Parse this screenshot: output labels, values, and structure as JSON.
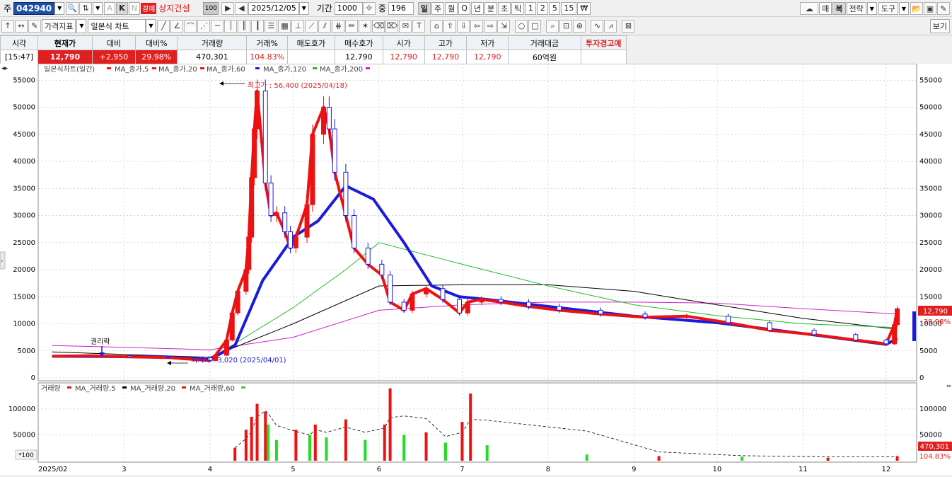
{
  "toolbar1": {
    "market_label": "주",
    "stock_code": "042940",
    "warning_badge": "경예",
    "stock_name": "상지건설",
    "check_value": "100",
    "date": "2025/12/05",
    "period_label": "기간",
    "period_value": "1000",
    "mid_label": "중",
    "mid_value": "196",
    "timeframes": [
      "일",
      "주",
      "월",
      "Q",
      "년",
      "분",
      "초",
      "틱",
      "1",
      "2",
      "5",
      "15"
    ],
    "currency_icon": "₩",
    "right_buttons": [
      "매",
      "복",
      "전략",
      "도구"
    ],
    "k_label": "K",
    "n_label": "N",
    "a_label": "A"
  },
  "toolbar2": {
    "indicator_button": "가격지표",
    "chart_type": "일본식 차트",
    "view_button": "보기"
  },
  "quote": {
    "headers": [
      "시각",
      "현재가",
      "대비",
      "대비%",
      "거래량",
      "거래%",
      "매도호가",
      "매수호가",
      "시가",
      "고가",
      "저가",
      "거래대금",
      "투자경고예"
    ],
    "values": [
      "[15:47]",
      "12,790",
      "+2,950",
      "29.98%",
      "470,301",
      "104.83%",
      "",
      "12,790",
      "12,790",
      "12,790",
      "12,790",
      "60억원",
      ""
    ]
  },
  "price_panel": {
    "legend_title": "일본식차트(일간)",
    "legend_items": [
      {
        "label": "MA_종가,5",
        "color": "#ee1111"
      },
      {
        "label": "MA_종가,20",
        "color": "#ee1111"
      },
      {
        "label": "MA_종가,60",
        "color": "#1a1adf"
      },
      {
        "label": "MA_종가,120",
        "color": "#22bb22"
      },
      {
        "label": "MA_종가,200",
        "color": "#000000"
      },
      {
        "label": "",
        "color": "#cc22cc"
      }
    ],
    "high_annotation": "최고가 : 56,400 (2025/04/18)",
    "low_annotation": "최저가 : 3,020 (2025/04/01)",
    "rights_annotation": "권리락",
    "y_ticks": [
      "55000",
      "50000",
      "45000",
      "40000",
      "35000",
      "30000",
      "25000",
      "20000",
      "15000",
      "10000",
      "5000",
      "0"
    ],
    "current_price_tag": "12,790",
    "current_pct_tag": "29.98%"
  },
  "volume_panel": {
    "legend_title": "거래량",
    "legend_items": [
      {
        "label": "MA_거래량,5",
        "color": "#ee1111"
      },
      {
        "label": "MA_거래량,20",
        "color": "#000000"
      },
      {
        "label": "MA_거래량,60",
        "color": "#ee1111"
      },
      {
        "label": "",
        "color": "#22dd22"
      }
    ],
    "y_ticks": [
      "100000",
      "50000"
    ],
    "scale_label": "*100",
    "volume_tag": "470,301",
    "volume_pct_tag": "104.83%"
  },
  "x_axis": {
    "labels": [
      "2025/02",
      "3",
      "4",
      "5",
      "6",
      "7",
      "8",
      "9",
      "10",
      "11",
      "12"
    ]
  },
  "colors": {
    "up": "#ee1111",
    "down": "#1a1adf",
    "ma60": "#1a1adf",
    "ma120": "#22bb22",
    "ma200": "#000000",
    "ma_magenta": "#cc22cc",
    "volume_up": "#ee1111",
    "volume_down": "#22dd22"
  },
  "chart_data": {
    "type": "candlestick",
    "price_ylim": [
      0,
      57000
    ],
    "volume_ylim": [
      0,
      130000
    ],
    "close_series": [
      [
        "2025/02/03",
        4000
      ],
      [
        "2025/02/17",
        4100
      ],
      [
        "2025/03/03",
        3900
      ],
      [
        "2025/03/17",
        3750
      ],
      [
        "2025/04/01",
        3200
      ],
      [
        "2025/04/03",
        4200
      ],
      [
        "2025/04/07",
        7000
      ],
      [
        "2025/04/09",
        12000
      ],
      [
        "2025/04/11",
        16000
      ],
      [
        "2025/04/14",
        20000
      ],
      [
        "2025/04/15",
        26000
      ],
      [
        "2025/04/16",
        37000
      ],
      [
        "2025/04/17",
        46000
      ],
      [
        "2025/04/18",
        53000
      ],
      [
        "2025/04/21",
        36000
      ],
      [
        "2025/04/23",
        30000
      ],
      [
        "2025/04/25",
        30500
      ],
      [
        "2025/04/28",
        27000
      ],
      [
        "2025/04/30",
        24000
      ],
      [
        "2025/05/02",
        26000
      ],
      [
        "2025/05/06",
        32000
      ],
      [
        "2025/05/08",
        45000
      ],
      [
        "2025/05/12",
        50000
      ],
      [
        "2025/05/14",
        46000
      ],
      [
        "2025/05/16",
        38000
      ],
      [
        "2025/05/20",
        30000
      ],
      [
        "2025/05/23",
        24000
      ],
      [
        "2025/05/28",
        21000
      ],
      [
        "2025/06/02",
        19000
      ],
      [
        "2025/06/05",
        14000
      ],
      [
        "2025/06/10",
        12500
      ],
      [
        "2025/06/13",
        15500
      ],
      [
        "2025/06/18",
        16500
      ],
      [
        "2025/06/24",
        14500
      ],
      [
        "2025/06/30",
        12000
      ],
      [
        "2025/07/03",
        14000
      ],
      [
        "2025/07/08",
        14500
      ],
      [
        "2025/07/15",
        14000
      ],
      [
        "2025/07/25",
        13200
      ],
      [
        "2025/08/05",
        12500
      ],
      [
        "2025/08/20",
        11800
      ],
      [
        "2025/09/05",
        11200
      ],
      [
        "2025/09/20",
        11400
      ],
      [
        "2025/10/05",
        10200
      ],
      [
        "2025/10/20",
        8800
      ],
      [
        "2025/11/05",
        8000
      ],
      [
        "2025/11/20",
        7000
      ],
      [
        "2025/12/01",
        6300
      ],
      [
        "2025/12/04",
        9840
      ],
      [
        "2025/12/05",
        12790
      ]
    ],
    "ma60_series": [
      [
        "2025/02/03",
        4000
      ],
      [
        "2025/03/15",
        3900
      ],
      [
        "2025/04/01",
        3400
      ],
      [
        "2025/04/10",
        6000
      ],
      [
        "2025/04/20",
        18000
      ],
      [
        "2025/05/01",
        26000
      ],
      [
        "2025/05/10",
        29000
      ],
      [
        "2025/05/20",
        35500
      ],
      [
        "2025/05/30",
        33000
      ],
      [
        "2025/06/10",
        25000
      ],
      [
        "2025/06/20",
        17000
      ],
      [
        "2025/06/30",
        15000
      ],
      [
        "2025/07/10",
        14500
      ],
      [
        "2025/08/01",
        13200
      ],
      [
        "2025/09/01",
        11400
      ],
      [
        "2025/10/01",
        10200
      ],
      [
        "2025/11/01",
        8200
      ],
      [
        "2025/12/01",
        6200
      ],
      [
        "2025/12/05",
        7300
      ]
    ],
    "ma120_series": [
      [
        "2025/04/01",
        3500
      ],
      [
        "2025/05/01",
        13000
      ],
      [
        "2025/05/20",
        20000
      ],
      [
        "2025/06/01",
        25000
      ],
      [
        "2025/07/01",
        21000
      ],
      [
        "2025/08/01",
        17000
      ],
      [
        "2025/09/01",
        13500
      ],
      [
        "2025/10/01",
        11500
      ],
      [
        "2025/11/01",
        10000
      ],
      [
        "2025/12/05",
        9300
      ]
    ],
    "ma200_series": [
      [
        "2025/02/03",
        4800
      ],
      [
        "2025/04/01",
        3800
      ],
      [
        "2025/05/01",
        10000
      ],
      [
        "2025/06/01",
        17000
      ],
      [
        "2025/07/01",
        17200
      ],
      [
        "2025/08/01",
        17200
      ],
      [
        "2025/09/01",
        16000
      ],
      [
        "2025/10/01",
        13500
      ],
      [
        "2025/11/01",
        11000
      ],
      [
        "2025/12/05",
        9000
      ]
    ],
    "ma_magenta_series": [
      [
        "2025/02/03",
        6000
      ],
      [
        "2025/04/01",
        5200
      ],
      [
        "2025/05/01",
        7500
      ],
      [
        "2025/06/01",
        12500
      ],
      [
        "2025/07/01",
        13500
      ],
      [
        "2025/08/01",
        14000
      ],
      [
        "2025/09/01",
        14000
      ],
      [
        "2025/10/01",
        13800
      ],
      [
        "2025/11/01",
        12800
      ],
      [
        "2025/12/05",
        11800
      ]
    ],
    "volume_bars": [
      [
        "2025/04/10",
        25000,
        "up"
      ],
      [
        "2025/04/14",
        60000,
        "up"
      ],
      [
        "2025/04/16",
        85000,
        "up"
      ],
      [
        "2025/04/18",
        110000,
        "up"
      ],
      [
        "2025/04/21",
        95000,
        "up"
      ],
      [
        "2025/04/22",
        70000,
        "down"
      ],
      [
        "2025/04/25",
        40000,
        "down"
      ],
      [
        "2025/05/02",
        60000,
        "up"
      ],
      [
        "2025/05/07",
        50000,
        "down"
      ],
      [
        "2025/05/09",
        70000,
        "up"
      ],
      [
        "2025/05/13",
        45000,
        "down"
      ],
      [
        "2025/05/20",
        80000,
        "up"
      ],
      [
        "2025/05/27",
        40000,
        "down"
      ],
      [
        "2025/06/03",
        70000,
        "up"
      ],
      [
        "2025/06/05",
        140000,
        "up"
      ],
      [
        "2025/06/10",
        50000,
        "down"
      ],
      [
        "2025/06/18",
        55000,
        "up"
      ],
      [
        "2025/06/25",
        35000,
        "down"
      ],
      [
        "2025/07/01",
        75000,
        "up"
      ],
      [
        "2025/07/04",
        130000,
        "up"
      ],
      [
        "2025/07/10",
        30000,
        "down"
      ],
      [
        "2025/08/15",
        12000,
        "down"
      ],
      [
        "2025/09/10",
        9000,
        "up"
      ],
      [
        "2025/10/10",
        8000,
        "down"
      ],
      [
        "2025/11/10",
        6000,
        "up"
      ],
      [
        "2025/12/05",
        9000,
        "up"
      ]
    ]
  }
}
